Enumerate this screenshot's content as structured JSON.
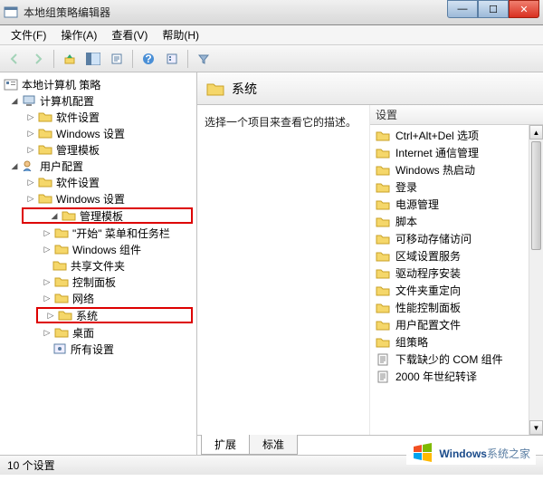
{
  "window": {
    "title": "本地组策略编辑器"
  },
  "menu": {
    "file": "文件(F)",
    "action": "操作(A)",
    "view": "查看(V)",
    "help": "帮助(H)"
  },
  "tree": {
    "root": "本地计算机 策略",
    "computer_config": "计算机配置",
    "cc_software": "软件设置",
    "cc_windows": "Windows 设置",
    "cc_admin": "管理模板",
    "user_config": "用户配置",
    "uc_software": "软件设置",
    "uc_windows": "Windows 设置",
    "uc_admin": "管理模板",
    "start_menu": "\"开始\" 菜单和任务栏",
    "windows_comp": "Windows 组件",
    "shared_folders": "共享文件夹",
    "control_panel": "控制面板",
    "network": "网络",
    "system": "系统",
    "desktop": "桌面",
    "all_settings": "所有设置"
  },
  "right": {
    "header_title": "系统",
    "description_prompt": "选择一个项目来查看它的描述。",
    "column_header": "设置",
    "items": [
      "Ctrl+Alt+Del 选项",
      "Internet 通信管理",
      "Windows 热启动",
      "登录",
      "电源管理",
      "脚本",
      "可移动存储访问",
      "区域设置服务",
      "驱动程序安装",
      "文件夹重定向",
      "性能控制面板",
      "用户配置文件",
      "组策略"
    ],
    "doc_items": [
      "下载缺少的 COM 组件",
      "2000 年世纪转译"
    ]
  },
  "tabs": {
    "extended": "扩展",
    "standard": "标准"
  },
  "status": {
    "count": "10 个设置"
  },
  "brand": {
    "win": "Windows",
    "rest": "系统之家"
  }
}
